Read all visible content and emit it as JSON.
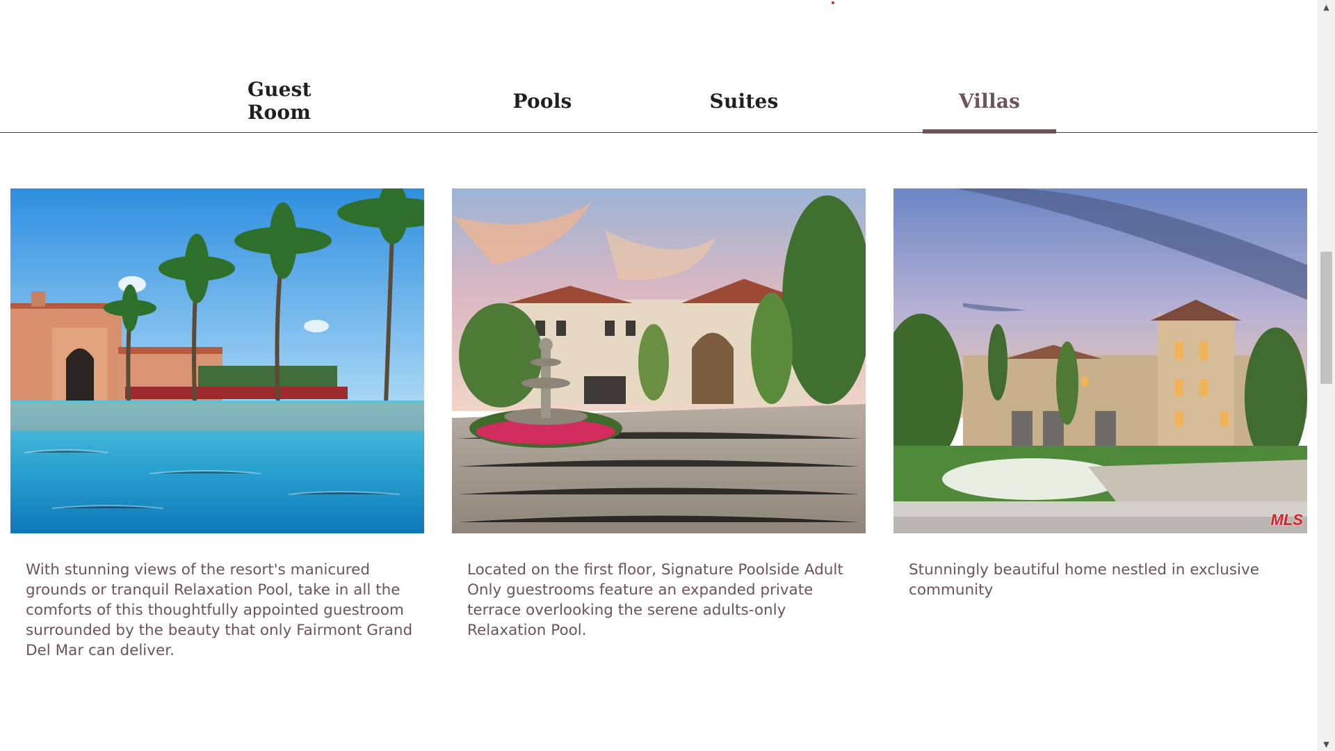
{
  "tabs": [
    {
      "label": "Guest Room",
      "active": false
    },
    {
      "label": "Pools",
      "active": false
    },
    {
      "label": "Suites",
      "active": false
    },
    {
      "label": "Villas",
      "active": true
    }
  ],
  "cards": [
    {
      "image": "resort-pool-with-palm-trees",
      "description": "With stunning views of the resort's manicured grounds or tranquil Relaxation Pool, take in all the comforts of this thoughtfully appointed guestroom surrounded by the beauty that only Fairmont Grand Del Mar can deliver."
    },
    {
      "image": "mediterranean-villa-with-fountain-driveway",
      "description": "Located on the first floor, Signature Poolside Adult Only guestrooms feature an expanded private terrace overlooking the serene adults-only Relaxation Pool."
    },
    {
      "image": "villa-at-dusk-with-garden",
      "watermark": "MLS",
      "description": "Stunningly beautiful home nestled in exclusive community"
    }
  ],
  "colors": {
    "accent": "#6b5257",
    "tab_text": "#1f1f1f",
    "body_text": "#6e5358",
    "divider": "#3a3a3a"
  },
  "scrollbar": {
    "up_icon": "triangle-up-icon",
    "down_icon": "triangle-down-icon"
  }
}
